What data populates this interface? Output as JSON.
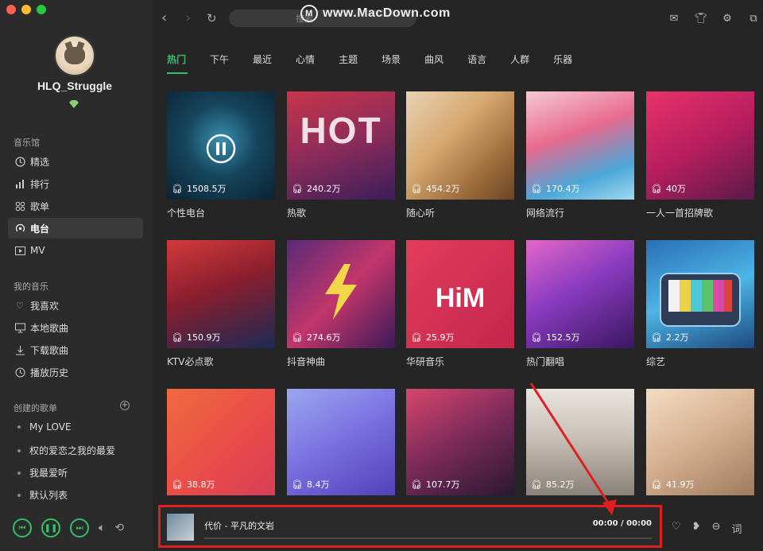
{
  "sidebar": {
    "username": "HLQ_Struggle",
    "section_music_hall": "音乐馆",
    "nav": [
      {
        "label": "精选",
        "icon": "selected-icon"
      },
      {
        "label": "排行",
        "icon": "ranking-icon"
      },
      {
        "label": "歌单",
        "icon": "playlist-icon"
      },
      {
        "label": "电台",
        "icon": "radio-icon"
      },
      {
        "label": "MV",
        "icon": "mv-icon"
      }
    ],
    "section_my_music": "我的音乐",
    "my_music": [
      {
        "label": "我喜欢",
        "icon": "heart-icon"
      },
      {
        "label": "本地歌曲",
        "icon": "monitor-icon"
      },
      {
        "label": "下载歌曲",
        "icon": "download-icon"
      },
      {
        "label": "播放历史",
        "icon": "clock-icon"
      }
    ],
    "section_created": "创建的歌单",
    "playlists": [
      "My LOVE",
      "权的爱恋之我的最爱",
      "我最爱听",
      "默认列表"
    ]
  },
  "topbar": {
    "search_placeholder": "搜索",
    "watermark": "www.MacDown.com"
  },
  "tabs": [
    "热门",
    "下午",
    "最近",
    "心情",
    "主题",
    "场景",
    "曲风",
    "语言",
    "人群",
    "乐器"
  ],
  "cards": [
    {
      "title": "个性电台",
      "plays": "1508.5万"
    },
    {
      "title": "热歌",
      "plays": "240.2万",
      "cover_text": "HOT"
    },
    {
      "title": "随心听",
      "plays": "454.2万"
    },
    {
      "title": "网络流行",
      "plays": "170.4万"
    },
    {
      "title": "一人一首招牌歌",
      "plays": "40万"
    },
    {
      "title": "KTV必点歌",
      "plays": "150.9万"
    },
    {
      "title": "抖音神曲",
      "plays": "274.6万"
    },
    {
      "title": "华研音乐",
      "plays": "25.9万",
      "cover_text": "HiM"
    },
    {
      "title": "热门翻唱",
      "plays": "152.5万"
    },
    {
      "title": "综艺",
      "plays": "2.2万"
    },
    {
      "title": "",
      "plays": "38.8万"
    },
    {
      "title": "",
      "plays": "8.4万"
    },
    {
      "title": "",
      "plays": "107.7万"
    },
    {
      "title": "",
      "plays": "85.2万"
    },
    {
      "title": "",
      "plays": "41.9万"
    }
  ],
  "player": {
    "title": "代价 - 平凡的文岩",
    "time": "00:00 / 00:00",
    "lyrics_label": "词"
  },
  "colors": {
    "accent": "#2fc26a",
    "annotation": "#e02020"
  }
}
